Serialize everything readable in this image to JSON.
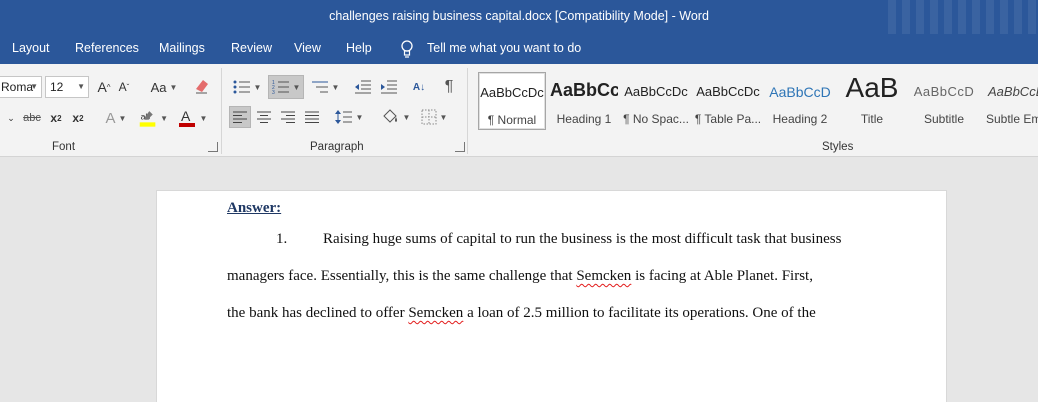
{
  "window": {
    "title": "challenges raising business capital.docx [Compatibility Mode]  -  Word"
  },
  "tabs": [
    "Layout",
    "References",
    "Mailings",
    "Review",
    "View",
    "Help"
  ],
  "tell_me": "Tell me what you want to do",
  "font": {
    "name": "Roma",
    "size": "12",
    "group_label": "Font"
  },
  "paragraph": {
    "group_label": "Paragraph"
  },
  "styles": {
    "group_label": "Styles",
    "items": [
      {
        "sample": "AaBbCcDc",
        "name": "¶ Normal"
      },
      {
        "sample": "AaBbCc",
        "name": "Heading 1"
      },
      {
        "sample": "AaBbCcDc",
        "name": "¶ No Spac..."
      },
      {
        "sample": "AaBbCcDc",
        "name": "¶ Table Pa..."
      },
      {
        "sample": "AaBbCcD",
        "name": "Heading 2"
      },
      {
        "sample": "AaB",
        "name": "Title"
      },
      {
        "sample": "AaBbCcD",
        "name": "Subtitle"
      },
      {
        "sample": "AaBbCcL",
        "name": "Subtle Em"
      }
    ]
  },
  "document": {
    "heading": "Answer:",
    "list_number": "1.",
    "line1": "Raising huge sums of capital to run the business is the most difficult task that business",
    "line2_a": "managers face. Essentially, this is the same challenge that ",
    "misspelled": "Semcken",
    "line2_b": " is facing at Able Planet. First,",
    "line3_a": "the bank has declined to offer ",
    "line3_b": " a loan of 2.5 million to facilitate its operations. One of the"
  },
  "colors": {
    "brand": "#2b579a",
    "highlight": "#ffff00",
    "font_color": "#c00000",
    "spell_error": "#e21b1b"
  }
}
